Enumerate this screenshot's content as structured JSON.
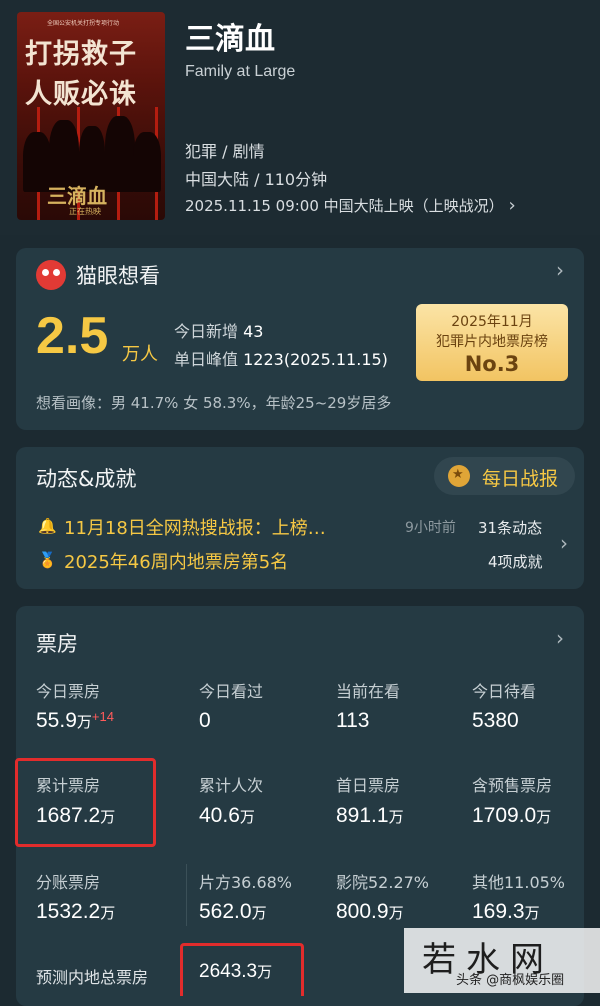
{
  "movie": {
    "poster_top": "全国公安机关打拐专项行动",
    "poster_line1": "打拐救子",
    "poster_line2": "人贩必诛",
    "poster_title": "三滴血",
    "poster_sub": "正在热映",
    "title": "三滴血",
    "subtitle": "Family at Large",
    "genre": "犯罪 / 剧情",
    "region_duration": "中国大陆 / 110分钟",
    "release": "2025.11.15 09:00 中国大陆上映（上映战况）",
    "release_chevron": "›"
  },
  "want": {
    "title": "猫眼想看",
    "count": "2.5",
    "count_unit": "万人",
    "today_add_label": "今日新增",
    "today_add_value": "43",
    "peak_label": "单日峰值",
    "peak_value": "1223(2025.11.15)",
    "rank_line1": "2025年11月",
    "rank_line2": "犯罪片内地票房榜",
    "rank_value": "No.3",
    "audience": "想看画像：男 41.7%  女 58.3%，年龄25~29岁居多",
    "chevron": "›"
  },
  "news": {
    "title": "动态&成就",
    "daily_report": "每日战报",
    "items": [
      {
        "icon": "🔔",
        "text": "11月18日全网热搜战报：上榜…",
        "time": "9小时前",
        "right": "31条动态"
      },
      {
        "icon": "🏅",
        "text": "2025年46周内地票房第5名",
        "time": "",
        "right": "4项成就"
      }
    ],
    "chevron": "›"
  },
  "box": {
    "title": "票房",
    "chevron": "›",
    "rows": [
      [
        {
          "label": "今日票房",
          "value": "55.9",
          "unit": "万",
          "extra": "+14"
        },
        {
          "label": "今日看过",
          "value": "0",
          "unit": "",
          "extra": ""
        },
        {
          "label": "当前在看",
          "value": "113",
          "unit": "",
          "extra": ""
        },
        {
          "label": "今日待看",
          "value": "5380",
          "unit": "",
          "extra": ""
        }
      ],
      [
        {
          "label": "累计票房",
          "value": "1687.2",
          "unit": "万",
          "extra": ""
        },
        {
          "label": "累计人次",
          "value": "40.6",
          "unit": "万",
          "extra": ""
        },
        {
          "label": "首日票房",
          "value": "891.1",
          "unit": "万",
          "extra": ""
        },
        {
          "label": "含预售票房",
          "value": "1709.0",
          "unit": "万",
          "extra": ""
        }
      ],
      [
        {
          "label": "分账票房",
          "value": "1532.2",
          "unit": "万",
          "extra": ""
        },
        {
          "label": "片方36.68%",
          "value": "562.0",
          "unit": "万",
          "extra": ""
        },
        {
          "label": "影院52.27%",
          "value": "800.9",
          "unit": "万",
          "extra": ""
        },
        {
          "label": "其他11.05%",
          "value": "169.3",
          "unit": "万",
          "extra": ""
        }
      ]
    ],
    "forecast_label": "预测内地总票房",
    "forecast_value": "2643.3",
    "forecast_unit": "万"
  },
  "watermark": {
    "big": "若水网",
    "small": "头条 @商枫娱乐圈"
  },
  "colors": {
    "background": "#1c2a31",
    "card": "#253a43",
    "accent_gold": "#f6c844",
    "highlight_red": "#e22c2c"
  }
}
